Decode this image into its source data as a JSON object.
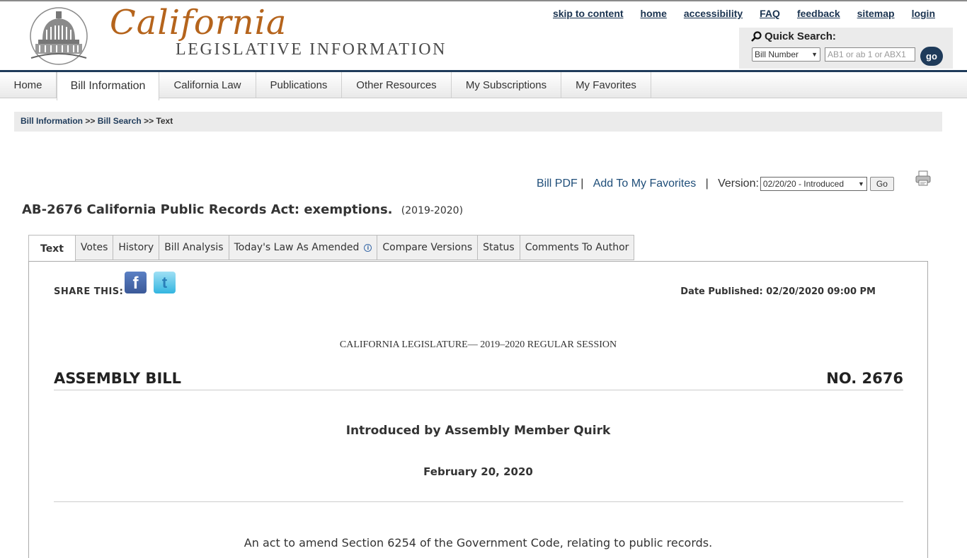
{
  "header": {
    "logo_script": "California",
    "logo_sub": "LEGISLATIVE INFORMATION",
    "top_links": [
      "skip to content",
      "home",
      "accessibility",
      "FAQ",
      "feedback",
      "sitemap",
      "login"
    ],
    "quick_search": {
      "title": "Quick Search:",
      "select_value": "Bill Number",
      "input_placeholder": "AB1 or ab 1 or ABX1",
      "go_label": "go"
    }
  },
  "nav": {
    "items": [
      "Home",
      "Bill Information",
      "California Law",
      "Publications",
      "Other Resources",
      "My Subscriptions",
      "My Favorites"
    ],
    "active": "Bill Information"
  },
  "breadcrumb": {
    "items": [
      "Bill Information",
      "Bill Search"
    ],
    "separator": ">>",
    "current": "Text"
  },
  "toolbar": {
    "bill_pdf": "Bill PDF",
    "add_favorites": "Add To My Favorites",
    "version_label": "Version:",
    "version_value": "02/20/20 - Introduced",
    "go_label": "Go"
  },
  "bill": {
    "title": "AB-2676 California Public Records Act: exemptions.",
    "session": "(2019-2020)"
  },
  "tabs": [
    "Text",
    "Votes",
    "History",
    "Bill Analysis",
    "Today's Law As Amended",
    "Compare Versions",
    "Status",
    "Comments To Author"
  ],
  "content": {
    "share_label": "SHARE THIS:",
    "date_published": "Date Published: 02/20/2020 09:00 PM",
    "session_line": "CALIFORNIA LEGISLATURE— 2019–2020 REGULAR SESSION",
    "bill_type": "ASSEMBLY BILL",
    "bill_number": "NO. 2676",
    "introduced_by": "Introduced by Assembly Member Quirk",
    "introduced_date": "February 20, 2020",
    "act_description": "An act to amend Section 6254 of the Government Code, relating to public records."
  }
}
